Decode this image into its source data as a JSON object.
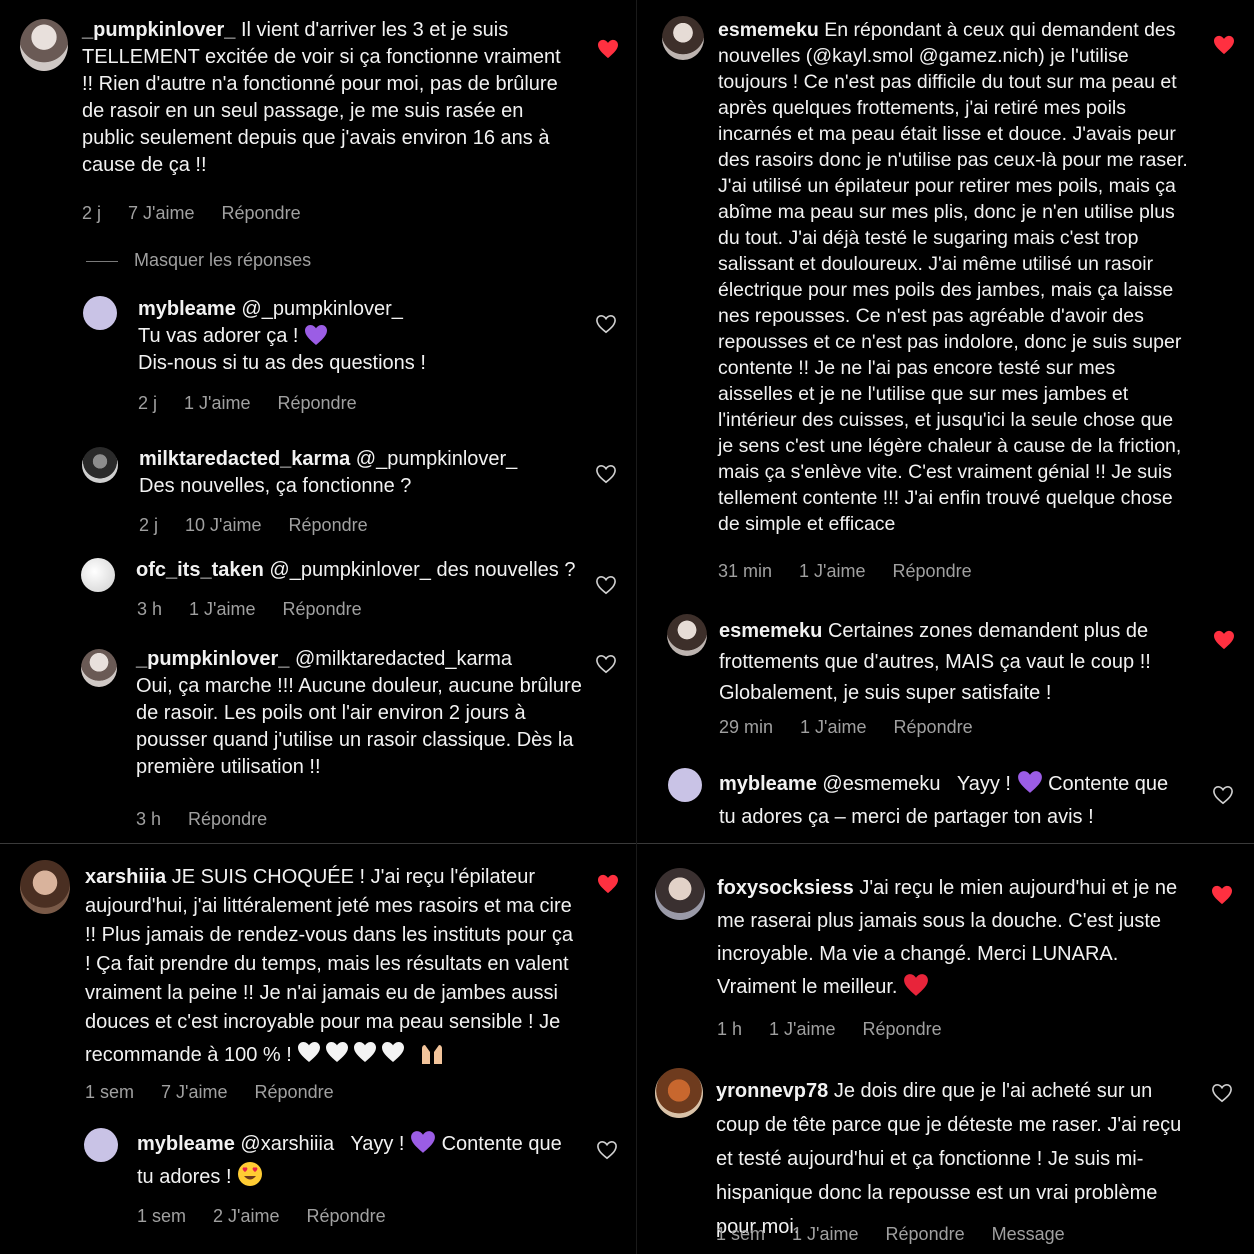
{
  "comments": [
    {
      "user": "_pumpkinlover_",
      "text": "Il vient d'arriver les 3 et je suis TELLEMENT excitée de voir si ça fonctionne vraiment !! Rien d'autre n'a fonctionné pour moi, pas de brûlure de rasoir en un seul passage, je me suis rasée en public seulement depuis que j'avais environ 16 ans à cause de ça !!",
      "time": "2 j",
      "likes": "7 J'aime",
      "reply": "Répondre",
      "liked": true,
      "hide_replies": "Masquer les réponses",
      "replies": [
        {
          "user": "mybleame",
          "mention": "@_pumpkinlover_",
          "text1": "Tu vas adorer ça !",
          "emoji": "purple-heart",
          "text2": "Dis-nous si tu as des questions !",
          "time": "2 j",
          "likes": "1 J'aime",
          "reply": "Répondre"
        },
        {
          "user": "milktaredacted_karma",
          "mention": "@_pumpkinlover_",
          "text": "Des nouvelles, ça fonctionne ?",
          "time": "2 j",
          "likes": "10 J'aime",
          "reply": "Répondre"
        },
        {
          "user": "ofc_its_taken",
          "mention": "@_pumpkinlover_",
          "text": "des nouvelles ?",
          "time": "3 h",
          "likes": "1 J'aime",
          "reply": "Répondre"
        },
        {
          "user": "_pumpkinlover_",
          "mention": "@milktaredacted_karma",
          "text": "Oui, ça marche !!! Aucune douleur, aucune brûlure de rasoir. Les poils ont l'air environ 2 jours à pousser quand j'utilise un rasoir classique. Dès la première utilisation !!",
          "time": "3 h",
          "reply": "Répondre"
        }
      ]
    },
    {
      "user": "esmemeku",
      "text": "En répondant à ceux qui demandent des nouvelles (@kayl.smol @gamez.nich) je l'utilise toujours ! Ce n'est pas difficile du tout sur ma peau et après quelques frottements, j'ai retiré mes poils incarnés et ma peau était lisse et douce. J'avais peur des rasoirs donc je n'utilise pas ceux-là pour me raser. J'ai utilisé un épilateur pour retirer mes poils, mais ça abîme ma peau sur mes plis, donc je n'en utilise plus du tout. J'ai déjà testé le sugaring mais c'est trop salissant et douloureux. J'ai même utilisé un rasoir électrique pour mes poils des jambes, mais ça laisse nes repousses. Ce n'est pas agréable d'avoir des repousses et ce n'est pas indolore, donc je suis super contente !! Je ne l'ai pas encore testé sur mes aisselles et je ne l'utilise que sur mes jambes et l'intérieur des cuisses, et jusqu'ici la seule chose que je sens c'est une légère chaleur à cause de la friction, mais ça s'enlève vite. C'est vraiment génial !! Je suis tellement contente !!! J'ai enfin trouvé quelque chose de simple et efficace",
      "time": "31 min",
      "likes": "1 J'aime",
      "reply": "Répondre",
      "liked": true
    },
    {
      "user": "esmemeku",
      "text": "Certaines zones demandent plus de frottements que d'autres, MAIS ça vaut le coup !! Globalement, je suis super satisfaite !",
      "time": "29 min",
      "likes": "1 J'aime",
      "reply": "Répondre",
      "liked": true
    },
    {
      "user": "mybleame",
      "mention": "@esmemeku",
      "text1": "Yayy !",
      "emoji": "purple-heart",
      "text2": "Contente que tu adores ça – merci de partager ton avis !"
    },
    {
      "user": "xarshiiia",
      "text": "JE SUIS CHOQUÉE ! J'ai reçu l'épilateur aujourd'hui, j'ai littéralement jeté mes rasoirs et ma cire !! Plus jamais de rendez-vous dans les instituts pour ça ! Ça fait prendre du temps, mais les résultats en valent vraiment la peine !! Je n'ai jamais eu de jambes aussi douces et c'est incroyable pour ma peau sensible ! Je recommande à 100 % !",
      "emojis": "white-hearts-raised-hands",
      "time": "1 sem",
      "likes": "7 J'aime",
      "reply": "Répondre",
      "liked": true,
      "replies": [
        {
          "user": "mybleame",
          "mention": "@xarshiiia",
          "text1": "Yayy !",
          "emoji": "purple-heart",
          "text2": "Contente que tu adores !",
          "emoji2": "heart-eyes",
          "time": "1 sem",
          "likes": "2 J'aime",
          "reply": "Répondre"
        }
      ]
    },
    {
      "user": "foxysocksiess",
      "text": "J'ai reçu le mien aujourd'hui et je ne me raserai plus jamais sous la douche. C'est juste incroyable. Ma vie a changé. Merci LUNARA. Vraiment le meilleur.",
      "emoji": "red-heart",
      "time": "1 h",
      "likes": "1 J'aime",
      "reply": "Répondre",
      "liked": true
    },
    {
      "user": "yronnevp78",
      "text": "Je dois dire que je l'ai acheté sur un coup de tête parce que je déteste me raser. J'ai reçu et testé aujourd'hui et ça fonctionne ! Je suis mi-hispanique donc la repousse est un vrai problème pour moi.",
      "time": "1 sem",
      "likes": "1 J'aime",
      "reply": "Répondre",
      "message": "Message",
      "liked": false
    }
  ],
  "colors": {
    "liked_heart": "#ff3040",
    "meta": "#a0a0a0",
    "purple_heart": "#9b5de5"
  }
}
